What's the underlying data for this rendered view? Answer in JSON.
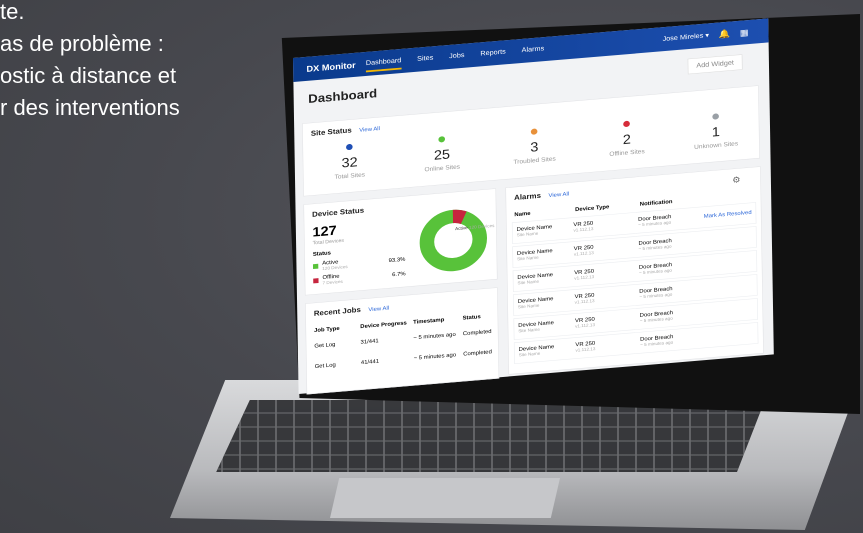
{
  "headline": {
    "line1": "te.",
    "line2": "as de problème :",
    "line3": "ostic à distance et",
    "line4": "r des interventions"
  },
  "app": {
    "brand": "DX Monitor",
    "nav": [
      "Dashboard",
      "Sites",
      "Jobs",
      "Reports",
      "Alarms"
    ],
    "user": "Jose Mireles",
    "page_title": "Dashboard",
    "add_widget": "Add Widget"
  },
  "site_status": {
    "title": "Site Status",
    "view_all": "View All",
    "stats": [
      {
        "value": "32",
        "label": "Total Sites",
        "color": "#1f4fb5"
      },
      {
        "value": "25",
        "label": "Online Sites",
        "color": "#58c23a"
      },
      {
        "value": "3",
        "label": "Troubled Sites",
        "color": "#e8913a"
      },
      {
        "value": "2",
        "label": "Offline Sites",
        "color": "#d62c3a"
      },
      {
        "value": "1",
        "label": "Unknown Sites",
        "color": "#9aa0a6"
      }
    ]
  },
  "device_status": {
    "title": "Device Status",
    "total": "127",
    "total_label": "Total Devices",
    "status_label": "Status",
    "items": [
      {
        "label": "Active",
        "sub": "120 Devices",
        "pct": "93.3%",
        "color": "#58c23a"
      },
      {
        "label": "Offline",
        "sub": "7 Devices",
        "pct": "6.7%",
        "color": "#c6253e"
      }
    ],
    "donut_label": "Active",
    "donut_sub": "120 Devices",
    "donut_fraction": 0.933
  },
  "alarms": {
    "title": "Alarms",
    "view_all": "View All",
    "headers": [
      "Name",
      "Device Type",
      "Notification"
    ],
    "rows": [
      {
        "name": "Device Name",
        "site": "Site Name",
        "type": "VR 250",
        "ver": "v1.112.13",
        "note": "Door Breach",
        "time": "~ 5 minutes ago",
        "action": "Mark As Resolved"
      },
      {
        "name": "Device Name",
        "site": "Site Name",
        "type": "VR 250",
        "ver": "v1.112.13",
        "note": "Door Breach",
        "time": "~ 5 minutes ago",
        "action": ""
      },
      {
        "name": "Device Name",
        "site": "Site Name",
        "type": "VR 250",
        "ver": "v1.112.13",
        "note": "Door Breach",
        "time": "~ 5 minutes ago",
        "action": ""
      },
      {
        "name": "Device Name",
        "site": "Site Name",
        "type": "VR 250",
        "ver": "v1.112.13",
        "note": "Door Breach",
        "time": "~ 5 minutes ago",
        "action": ""
      },
      {
        "name": "Device Name",
        "site": "Site Name",
        "type": "VR 250",
        "ver": "v1.112.13",
        "note": "Door Breach",
        "time": "~ 5 minutes ago",
        "action": ""
      },
      {
        "name": "Device Name",
        "site": "Site Name",
        "type": "VR 250",
        "ver": "v1.112.13",
        "note": "Door Breach",
        "time": "~ 5 minutes ago",
        "action": ""
      }
    ]
  },
  "recent_jobs": {
    "title": "Recent Jobs",
    "view_all": "View All",
    "headers": [
      "Job Type",
      "Device Progress",
      "Timestamp",
      "Status"
    ],
    "rows": [
      {
        "type": "Get Log",
        "progress": "31/441",
        "time": "~ 5 minutes ago",
        "status": "Completed"
      },
      {
        "type": "Get Log",
        "progress": "41/441",
        "time": "~ 5 minutes ago",
        "status": "Completed"
      }
    ]
  }
}
